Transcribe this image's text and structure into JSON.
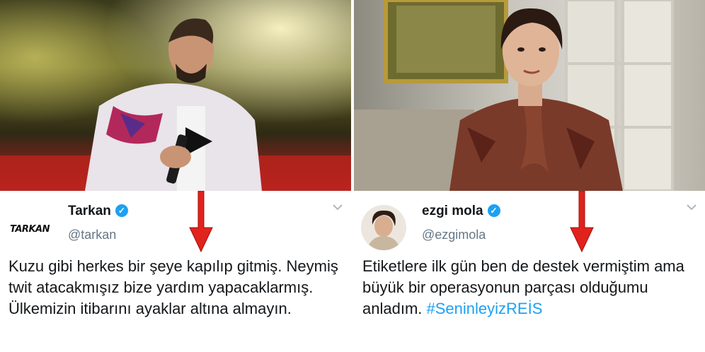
{
  "left": {
    "name": "Tarkan",
    "handle": "@tarkan",
    "logo_text": "TARKAN",
    "body": "Kuzu gibi herkes bir şeye kapılıp gitmiş. Neymiş twit atacakmışız bize yardım yapacaklarmış. Ülkemizin itibarını ayaklar altına almayın."
  },
  "right": {
    "name": "ezgi mola",
    "handle": "@ezgimola",
    "body": "Etiketlere ilk gün ben de destek vermiştim ama büyük bir operasyonun parçası olduğumu anladım.",
    "hashtag": "#SeninleyizREİS"
  },
  "icons": {
    "verified": "verified-badge-icon",
    "chevron": "chevron-down-icon",
    "arrow": "red-arrow-down-icon"
  },
  "colors": {
    "verified": "#1da1f2",
    "hashtag": "#1da1f2",
    "arrow": "#e0231c",
    "handle": "#657786",
    "text": "#14171a"
  }
}
